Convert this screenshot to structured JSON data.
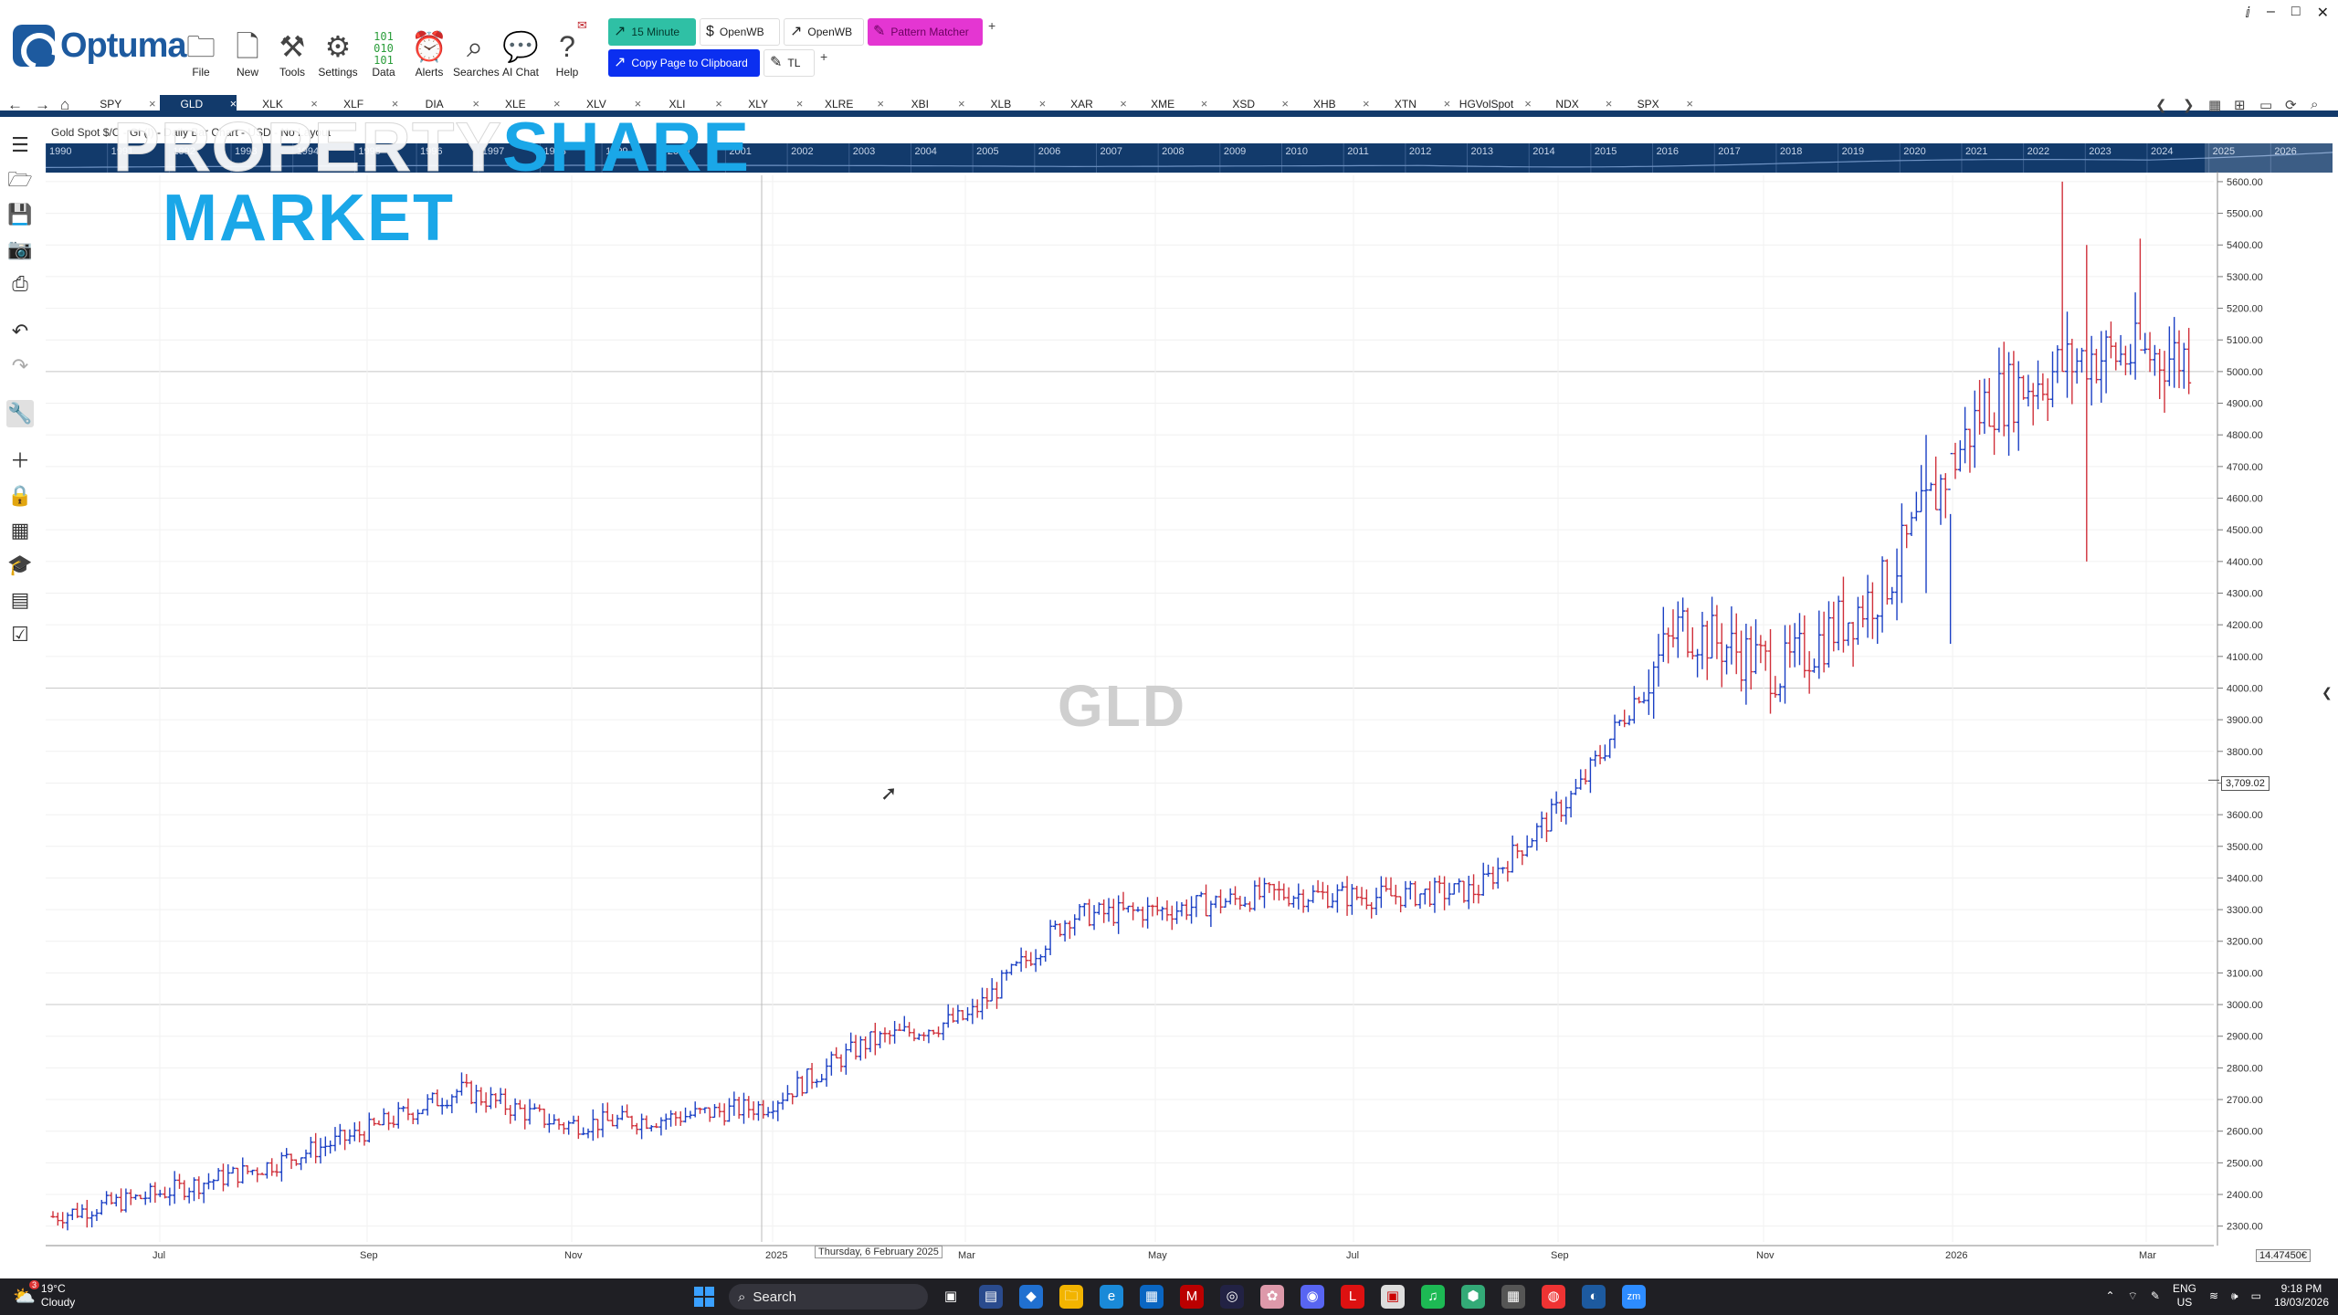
{
  "app": {
    "brand": "Optuma"
  },
  "toolbar": {
    "buttons": [
      {
        "label": "File",
        "icon": "folder-icon"
      },
      {
        "label": "New",
        "icon": "new-icon"
      },
      {
        "label": "Tools",
        "icon": "tools-icon"
      },
      {
        "label": "Settings",
        "icon": "gear-icon"
      },
      {
        "label": "Data",
        "icon": "data-icon"
      },
      {
        "label": "Alerts",
        "icon": "alarm-icon"
      },
      {
        "label": "Searches",
        "icon": "search-icon"
      },
      {
        "label": "AI Chat",
        "icon": "chat-icon"
      },
      {
        "label": "Help",
        "icon": "help-icon"
      }
    ],
    "quick": {
      "fifteen_minute": "15 Minute",
      "openwb_1": "OpenWB",
      "openwb_2": "OpenWB",
      "pattern_matcher": "Pattern Matcher",
      "copy_page": "Copy Page to Clipboard",
      "tl": "TL"
    },
    "colors": {
      "fifteen_minute": "#2fc0a5",
      "pattern_matcher": "#e436d2",
      "copy_page": "#0b2ff0"
    }
  },
  "tabs": [
    "SPY",
    "GLD",
    "XLK",
    "XLF",
    "DIA",
    "XLE",
    "XLV",
    "XLI",
    "XLY",
    "XLRE",
    "XBI",
    "XLB",
    "XAR",
    "XME",
    "XSD",
    "XHB",
    "XTN",
    "HGVolSpot",
    "NDX",
    "SPX"
  ],
  "active_tab": "GLD",
  "chart": {
    "info_text": "Gold Spot $/C - Gl (I) - Daily Bar Chart - USD - No Layout",
    "watermark": "GLD",
    "overlay_brand_line1a": "PROPERTY",
    "overlay_brand_line1b": "SHARE",
    "overlay_brand_line2": "MARKET",
    "date_tooltip": "Thursday, 6 February 2025",
    "price_tag": "3,709.02",
    "scale_tag": "14.47450€",
    "overview_years": [
      "1990",
      "1991",
      "1992",
      "1993",
      "1994",
      "1995",
      "1996",
      "1997",
      "1998",
      "1999",
      "2000",
      "2001",
      "2002",
      "2003",
      "2004",
      "2005",
      "2006",
      "2007",
      "2008",
      "2009",
      "2010",
      "2011",
      "2012",
      "2013",
      "2014",
      "2015",
      "2016",
      "2017",
      "2018",
      "2019",
      "2020",
      "2021",
      "2022",
      "2023",
      "2024",
      "2025",
      "2026"
    ]
  },
  "chart_data": {
    "type": "ohlc",
    "title": "",
    "xlabel": "",
    "ylabel": "",
    "ylim": [
      2250,
      5620
    ],
    "y_ticks": [
      "5600.00",
      "5500.00",
      "5400.00",
      "5300.00",
      "5200.00",
      "5100.00",
      "5000.00",
      "4900.00",
      "4800.00",
      "4700.00",
      "4600.00",
      "4500.00",
      "4400.00",
      "4300.00",
      "4200.00",
      "4100.00",
      "4000.00",
      "3900.00",
      "3800.00",
      "3700.00",
      "3600.00",
      "3500.00",
      "3400.00",
      "3300.00",
      "3200.00",
      "3100.00",
      "3000.00",
      "2900.00",
      "2800.00",
      "2700.00",
      "2600.00",
      "2500.00",
      "2400.00",
      "2300.00"
    ],
    "x_ticks": [
      "Jul",
      "Sep",
      "Nov",
      "2025",
      "Mar",
      "May",
      "Jul",
      "Sep",
      "Nov",
      "2026",
      "Mar"
    ],
    "series": [
      {
        "points": [
          [
            "Jun 2024",
            2330
          ],
          [
            "Jul 2024",
            2400
          ],
          [
            "Aug 2024",
            2480
          ],
          [
            "Sep 2024",
            2590
          ],
          [
            "Oct 2024",
            2730
          ],
          [
            "Nov 2024",
            2620
          ],
          [
            "Dec 2024",
            2640
          ],
          [
            "Jan 2025",
            2680
          ],
          [
            "Feb 2025",
            2880
          ],
          [
            "Mar 2025",
            2960
          ],
          [
            "Apr 2025",
            3280
          ],
          [
            "May 2025",
            3300
          ],
          [
            "Jun 2025",
            3350
          ],
          [
            "Jul 2025",
            3340
          ],
          [
            "Aug 2025",
            3360
          ],
          [
            "Sep 2025",
            3680
          ],
          [
            "Oct 2025",
            4200
          ],
          [
            "Nov 2025",
            4050
          ],
          [
            "Dec 2025",
            4320
          ],
          [
            "Jan 2026",
            4900
          ],
          [
            "Feb 2026",
            5050
          ],
          [
            "Mar 2026",
            5050
          ]
        ]
      }
    ],
    "grid": true,
    "up_color": "#1a3fc4",
    "down_color": "#d0303a"
  },
  "lefttools": [
    "list-icon",
    "folder-open-icon",
    "save-icon",
    "camera-icon",
    "print-icon",
    "undo-icon",
    "redo-icon",
    "wrench-icon",
    "crosshair-icon",
    "lock-icon",
    "grid-icon",
    "hat-icon",
    "page-icon",
    "checklist-icon"
  ],
  "taskbar": {
    "weather_temp": "19°C",
    "weather_desc": "Cloudy",
    "weather_badge": "3",
    "search_placeholder": "Search",
    "lang": "ENG",
    "region": "US",
    "time": "9:18 PM",
    "date": "18/03/2026"
  }
}
